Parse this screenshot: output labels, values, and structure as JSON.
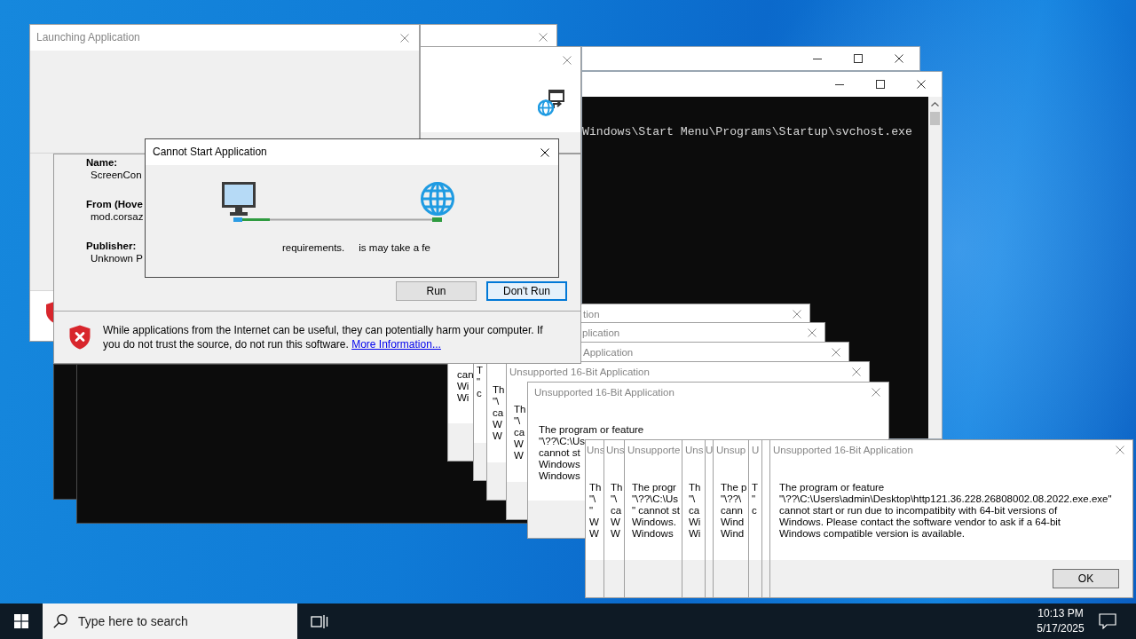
{
  "windows": [
    {
      "kind": "console"
    },
    {
      "kind": "console",
      "lines": [
        "Windows\\Start Menu\\Programs\\Startup\\svchost.exe"
      ]
    },
    {
      "kind": "console"
    },
    {
      "kind": "console"
    },
    {
      "kind": "unsupported",
      "title": "tion",
      "active": false,
      "lines": [
        "can",
        "Wi",
        "Wi"
      ]
    },
    {
      "kind": "unsupported",
      "title": "plication",
      "active": false,
      "lines": [
        "T",
        "\"",
        "c"
      ]
    },
    {
      "kind": "unsupported",
      "title": "Application",
      "active": false,
      "lines": [
        "Th",
        "\"\\",
        "ca",
        "W",
        "W"
      ]
    },
    {
      "kind": "unsupported",
      "title": "Unsupported 16-Bit Application",
      "active": false,
      "lines": [
        "Th",
        "\"\\",
        "ca",
        "W",
        "W"
      ]
    },
    {
      "kind": "unsupported",
      "title": "Unsupported 16-Bit Application",
      "active": false,
      "lines": [
        "The program or feature",
        "\"\\??\\C:\\Us",
        "cannot st",
        "Windows",
        "Windows"
      ]
    },
    {
      "kind": "unsupported",
      "title": "Uns",
      "active": false,
      "lines": [
        "Th",
        "\"\\",
        "\"",
        "W",
        "W"
      ]
    },
    {
      "kind": "unsupported",
      "title": "Uns",
      "active": false,
      "lines": [
        "Th",
        "\"\\",
        "ca",
        "W",
        "W"
      ]
    },
    {
      "kind": "unsupported",
      "title": "Unsupporte",
      "active": false,
      "lines": [
        "The progr",
        "\"\\??\\C:\\Us",
        "\" cannot st",
        "Windows.",
        "Windows"
      ]
    },
    {
      "kind": "unsupported",
      "title": "Uns",
      "active": false,
      "lines": [
        "Th",
        "\"\\",
        "ca",
        "Wi",
        "Wi"
      ]
    },
    {
      "kind": "unsupported",
      "title": "U",
      "active": false
    },
    {
      "kind": "unsupported",
      "title": "Unsup",
      "active": false,
      "lines": [
        "The p",
        "\"\\??\\",
        "cann",
        "Wind",
        "Wind"
      ]
    },
    {
      "kind": "unsupported",
      "title": "U",
      "active": false,
      "lines": [
        "T",
        "\"",
        "c"
      ]
    },
    {
      "kind": "unsupported"
    },
    {
      "kind": "unsupported",
      "title": "Unsupported 16-Bit Application",
      "active": false,
      "lines": [
        "The program or feature",
        "\"\\??\\C:\\Users\\admin\\Desktop\\http121.36.228.26808002.08.2022.exe.exe\"",
        "cannot start or run due to incompatibity with 64-bit versions of",
        "Windows. Please contact the software vendor to ask if a 64-bit",
        "Windows compatible version is available."
      ],
      "buttons": [
        {
          "label": "OK",
          "focused": false
        }
      ]
    },
    {
      "kind": "blank"
    },
    {
      "kind": "progress"
    },
    {
      "kind": "launching",
      "title": "Launching Application",
      "active": false
    },
    {
      "kind": "security",
      "fields": [
        {
          "label": "Name:",
          "value": "ScreenCon"
        },
        {
          "label": "From (Hove",
          "value": "mod.corsaz"
        },
        {
          "label": "Publisher:",
          "value": "Unknown P"
        }
      ],
      "buttons": [
        {
          "label": "Run",
          "focused": false
        },
        {
          "label": "Don't Run",
          "focused": true
        }
      ],
      "warning": {
        "text": "While applications from the Internet can be useful, they can potentially harm your computer. If you do not trust the source, do not run this software.",
        "link": "More Information..."
      }
    },
    {
      "kind": "cannot_start",
      "title": "Cannot Start Application",
      "active": true,
      "texts": [
        "requirements.",
        "is may take a fe"
      ]
    }
  ],
  "taskbar": {
    "search": {
      "placeholder": "Type here to search"
    },
    "clock": {
      "time": "10:13 PM",
      "date": "5/17/2025"
    }
  }
}
